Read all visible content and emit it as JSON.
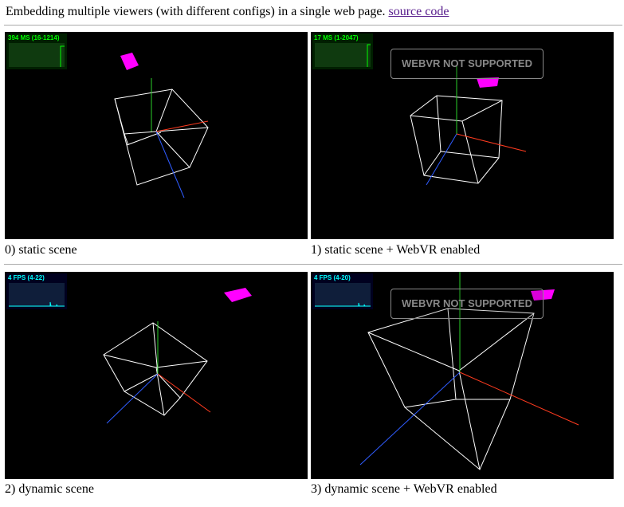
{
  "header": {
    "text": "Embedding multiple viewers (with different configs) in a single web page.",
    "link_label": "source code"
  },
  "viewers": [
    {
      "caption": "0) static scene",
      "stats_label": "394 MS (16-1214)",
      "stats_kind": "ms",
      "vr_button": null
    },
    {
      "caption": "1) static scene + WebVR enabled",
      "stats_label": "17 MS (1-2047)",
      "stats_kind": "ms",
      "vr_button": "WEBVR NOT SUPPORTED"
    },
    {
      "caption": "2) dynamic scene",
      "stats_label": "4 FPS (4-22)",
      "stats_kind": "fps",
      "vr_button": null
    },
    {
      "caption": "3) dynamic scene + WebVR enabled",
      "stats_label": "4 FPS (4-20)",
      "stats_kind": "fps",
      "vr_button": "WEBVR NOT SUPPORTED"
    }
  ],
  "colors": {
    "cube_edges": "#ffffff",
    "axis_x": "#ff3b1f",
    "axis_y": "#2ad12a",
    "axis_z": "#2f5cff",
    "marker": "#ff00ff",
    "stats_ms": "#00ff00",
    "stats_fps": "#00ffff",
    "link": "#551a8b"
  }
}
